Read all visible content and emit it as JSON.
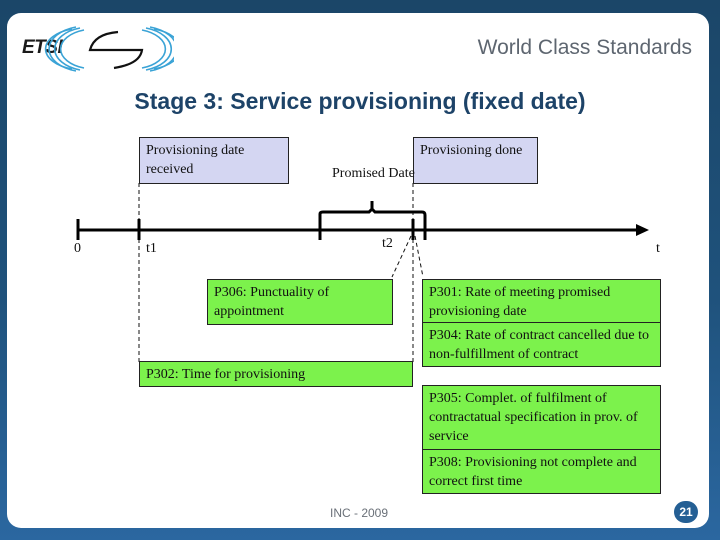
{
  "header": {
    "logo_text": "ETSI",
    "tagline": "World Class Standards",
    "title": "Stage 3: Service provisioning (fixed date)"
  },
  "timeline": {
    "origin_label": "0",
    "t1_label": "t1",
    "t2_label": "t2",
    "axis_label": "t",
    "promised_date_label": "Promised Date",
    "event_received": "Provisioning date received",
    "event_done": "Provisioning done"
  },
  "metrics": [
    {
      "id": "P306",
      "text": "P306: Punctuality  of appointment"
    },
    {
      "id": "P302",
      "text": "P302: Time for provisioning"
    },
    {
      "id": "P301",
      "text": "P301: Rate of meeting promised provisioning date"
    },
    {
      "id": "P304",
      "text": "P304: Rate of contract cancelled due to non-fulfillment of contract"
    },
    {
      "id": "P305",
      "text": "P305: Complet. of fulfilment of contractatual specification in prov. of service"
    },
    {
      "id": "P308",
      "text": "P308: Provisioning not complete and correct first time"
    }
  ],
  "footer": {
    "event": "INC - 2009",
    "page_number": "21"
  },
  "colors": {
    "frame_dark": "#1b4668",
    "frame_light": "#2b67a0",
    "title": "#1d4368",
    "event_box": "#d4d6f2",
    "metric_box": "#7cf24c"
  }
}
